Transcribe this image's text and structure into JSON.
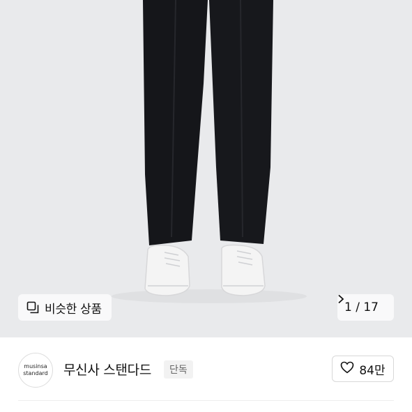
{
  "gallery": {
    "similar_label": "비슷한 상품",
    "pager": "1 / 17",
    "current": 1,
    "total": 17
  },
  "brand": {
    "logo_line1": "musinsa",
    "logo_line2": "standard",
    "name": "무신사 스탠다드",
    "badge": "단독"
  },
  "like": {
    "count": "84만"
  },
  "icons": {
    "similar": "copy-icon",
    "next": "chevron-right-icon",
    "like": "heart-icon"
  },
  "colors": {
    "image_bg": "#e9eaec",
    "pants": "#16171a",
    "sneakers": "#f4f4f4"
  }
}
